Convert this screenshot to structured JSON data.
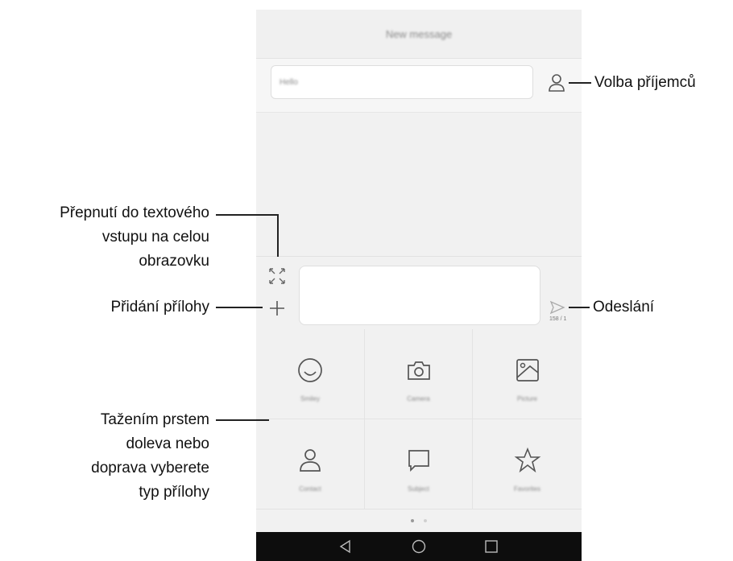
{
  "screen": {
    "title": "New message",
    "recipient_placeholder": "Hello",
    "char_counter": "158 / 1",
    "attachments": [
      {
        "label": "Smiley",
        "icon": "smiley-icon"
      },
      {
        "label": "Camera",
        "icon": "camera-icon"
      },
      {
        "label": "Picture",
        "icon": "picture-icon"
      },
      {
        "label": "Contact",
        "icon": "contact-icon"
      },
      {
        "label": "Subject",
        "icon": "subject-icon"
      },
      {
        "label": "Favorites",
        "icon": "star-icon"
      }
    ]
  },
  "callouts": {
    "recipients": "Volba příjemců",
    "fullscreen_line1": "Přepnutí do textového",
    "fullscreen_line2": "vstupu na celou",
    "fullscreen_line3": "obrazovku",
    "attach": "Přidání přílohy",
    "send": "Odeslání",
    "swipe_line1": "Tažením prstem",
    "swipe_line2": "doleva nebo",
    "swipe_line3": "doprava vyberete",
    "swipe_line4": "typ přílohy"
  }
}
